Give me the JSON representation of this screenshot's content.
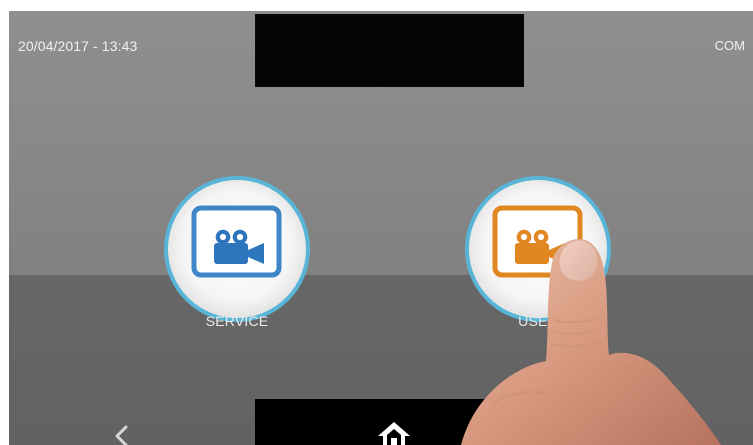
{
  "header": {
    "datetime": "20/04/2017 - 13:43",
    "mode": "COM"
  },
  "buttons": {
    "service": {
      "label": "SERVICE",
      "accent": "#3f86c8",
      "icon": "video-camera-icon"
    },
    "user": {
      "label": "USER",
      "accent": "#e08722",
      "icon": "video-camera-icon"
    }
  },
  "navigation": {
    "back_icon": "chevron-left-icon",
    "home_icon": "home-icon"
  },
  "colors": {
    "upper_panel": "#8a8a8a",
    "lower_panel": "#656565",
    "ring": "#59b5d8"
  }
}
